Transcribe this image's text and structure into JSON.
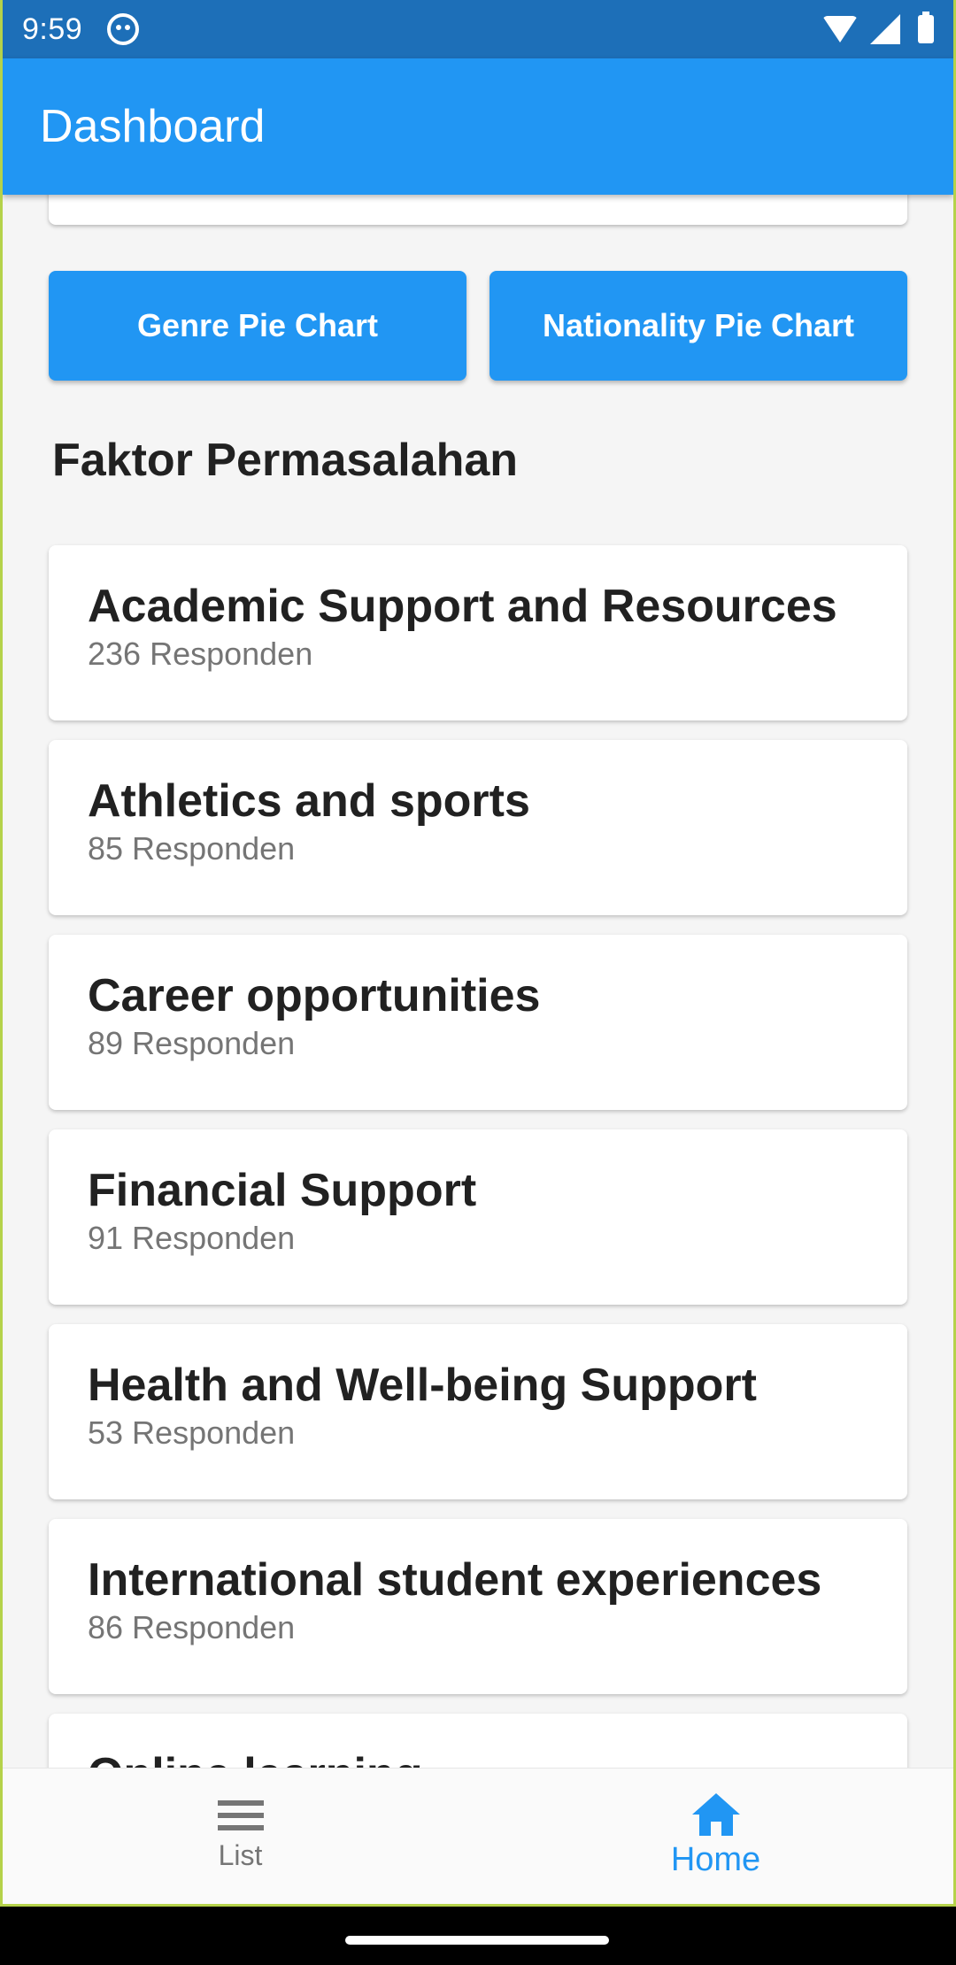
{
  "status_bar": {
    "time": "9:59"
  },
  "app_bar": {
    "title": "Dashboard"
  },
  "buttons": {
    "genre": "Genre Pie Chart",
    "nationality": "Nationality Pie Chart"
  },
  "section": {
    "title": "Faktor Permasalahan"
  },
  "items": [
    {
      "title": "Academic Support and Resources",
      "subtitle": "236 Responden"
    },
    {
      "title": "Athletics and sports",
      "subtitle": "85 Responden"
    },
    {
      "title": "Career opportunities",
      "subtitle": "89 Responden"
    },
    {
      "title": "Financial Support",
      "subtitle": "91 Responden"
    },
    {
      "title": "Health and Well-being Support",
      "subtitle": "53 Responden"
    },
    {
      "title": "International student experiences",
      "subtitle": "86 Responden"
    },
    {
      "title": "Online learning",
      "subtitle": ""
    }
  ],
  "bottom_nav": {
    "list_label": "List",
    "home_label": "Home",
    "active": "Home"
  },
  "colors": {
    "primary": "#2196f3",
    "status_bar": "#1d6fb8",
    "background": "#f5f5f5"
  }
}
